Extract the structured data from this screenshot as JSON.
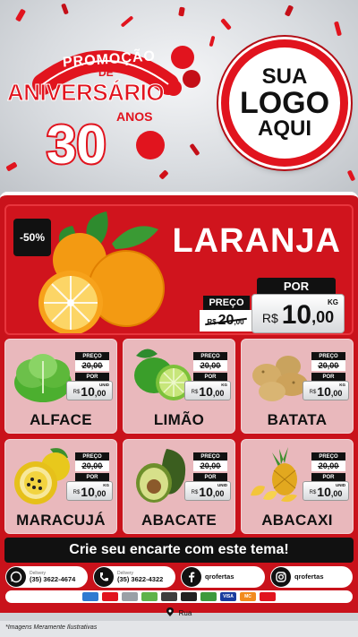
{
  "header": {
    "promo_line1": "PROMOÇÃO",
    "promo_line2": "DE",
    "promo_line3": "ANIVERSÁRIO",
    "promo_years": "30",
    "promo_years_label": "ANOS",
    "logo_text": [
      "SUA",
      "LOGO",
      "AQUI"
    ]
  },
  "featured": {
    "discount": "-50%",
    "name": "LARANJA",
    "por_label": "POR",
    "preco_label": "PREÇO",
    "old_currency": "R$",
    "old_price_int": "20",
    "old_price_dec": ",00",
    "currency": "R$",
    "price_int": "10",
    "price_dec": ",00",
    "unit": "KG",
    "image_icon": "orange-icon"
  },
  "products": [
    {
      "name": "ALFACE",
      "preco_label": "PREÇO",
      "old_price": "20,00",
      "por_label": "POR",
      "currency": "R$",
      "price_int": "10",
      "price_dec": ",00",
      "unit": "UNID",
      "icon": "lettuce-icon"
    },
    {
      "name": "LIMÃO",
      "preco_label": "PREÇO",
      "old_price": "20,00",
      "por_label": "POR",
      "currency": "R$",
      "price_int": "10",
      "price_dec": ",00",
      "unit": "KG",
      "icon": "lime-icon"
    },
    {
      "name": "BATATA",
      "preco_label": "PREÇO",
      "old_price": "20,00",
      "por_label": "POR",
      "currency": "R$",
      "price_int": "10",
      "price_dec": ",00",
      "unit": "KG",
      "icon": "potato-icon"
    },
    {
      "name": "MARACUJÁ",
      "preco_label": "PREÇO",
      "old_price": "20,00",
      "por_label": "POR",
      "currency": "R$",
      "price_int": "10",
      "price_dec": ",00",
      "unit": "KG",
      "icon": "passion-fruit-icon"
    },
    {
      "name": "ABACATE",
      "preco_label": "PREÇO",
      "old_price": "20,00",
      "por_label": "POR",
      "currency": "R$",
      "price_int": "10",
      "price_dec": ",00",
      "unit": "UNID",
      "icon": "avocado-icon"
    },
    {
      "name": "ABACAXI",
      "preco_label": "PREÇO",
      "old_price": "20,00",
      "por_label": "POR",
      "currency": "R$",
      "price_int": "10",
      "price_dec": ",00",
      "unit": "UNID",
      "icon": "pineapple-icon"
    }
  ],
  "cta": {
    "label": "Crie seu encarte com este tema!"
  },
  "contacts": [
    {
      "label": "Delivery",
      "value": "(35) 3622-4674",
      "icon": "whatsapp-icon"
    },
    {
      "label": "Delivery",
      "value": "(35) 3622-4322",
      "icon": "phone-icon"
    },
    {
      "label": "",
      "value": "qrofertas",
      "icon": "facebook-icon"
    },
    {
      "label": "",
      "value": "qrofertas",
      "icon": "instagram-icon"
    }
  ],
  "payments": [
    "VISA",
    "MC"
  ],
  "address": {
    "text": "Rua",
    "icon": "map-pin-icon"
  },
  "disclaimer": "*Imagens Meramente Ilustrativas",
  "colors": {
    "brand_red": "#e1141e",
    "dark": "#111111",
    "card_pink": "#e9b8bc"
  }
}
